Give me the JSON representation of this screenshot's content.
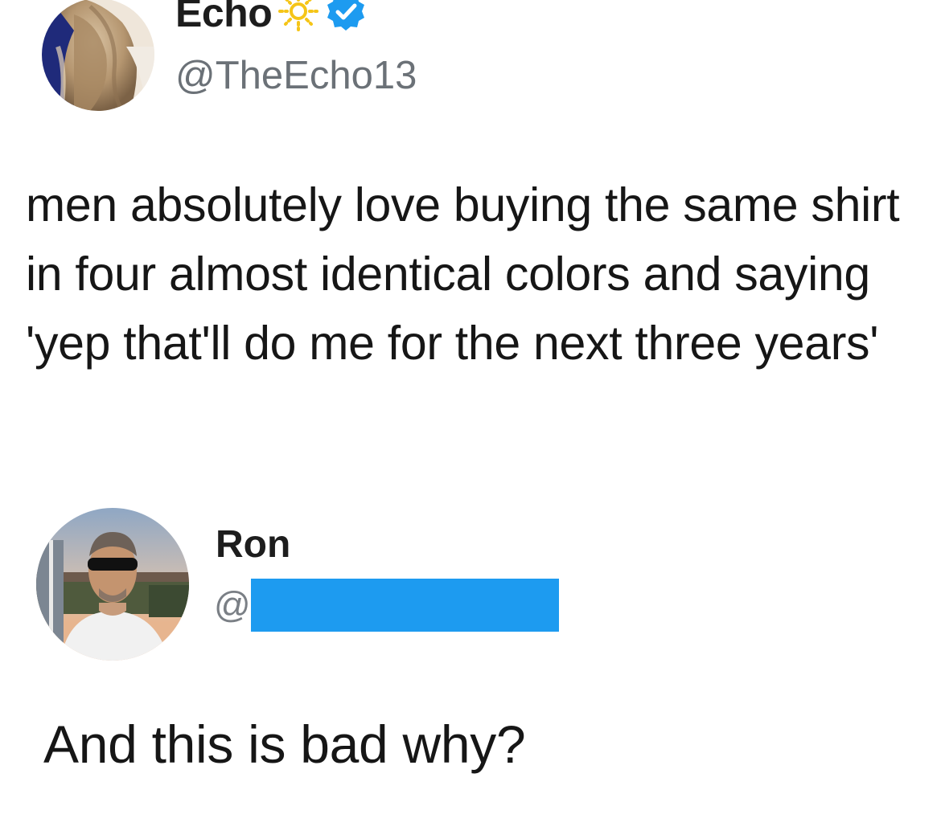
{
  "original_tweet": {
    "display_name": "Echo",
    "name_emoji_icon": "sun-icon",
    "verified_icon": "verified-badge-icon",
    "handle": "@TheEcho13",
    "text": "men absolutely love buying the same shirt in four almost identical colors and saying 'yep that'll do me for the next three years'"
  },
  "reply": {
    "display_name": "Ron",
    "handle_prefix": "@",
    "handle_redacted": true,
    "text": "And this is bad why?"
  },
  "colors": {
    "verified_blue": "#1d9bf0",
    "redaction_blue": "#1d9bf0",
    "handle_gray": "#6b7177",
    "text_black": "#161616",
    "sun_yellow": "#f5c518"
  }
}
